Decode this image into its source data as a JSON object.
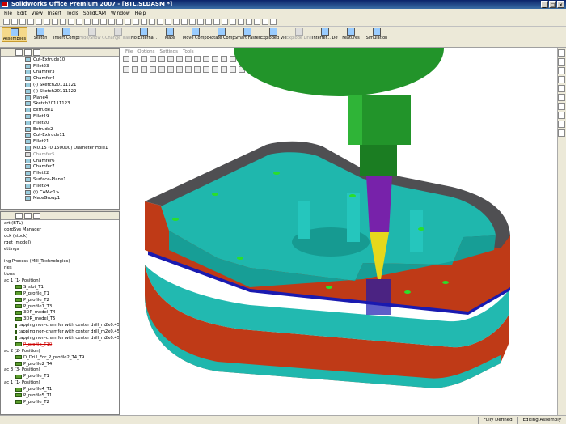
{
  "title": "SolidWorks Office Premium 2007 - [BTL.SLDASM *]",
  "menu": [
    "File",
    "Edit",
    "View",
    "Insert",
    "Tools",
    "SolidCAM",
    "Window",
    "Help"
  ],
  "commands": [
    {
      "label": "Assemblies",
      "state": "active"
    },
    {
      "label": "Sketch",
      "state": "normal"
    },
    {
      "label": "Insert Compon...",
      "state": "normal"
    },
    {
      "label": "Hide/Show Compon...",
      "state": "disabled"
    },
    {
      "label": "Change Transpar...",
      "state": "disabled"
    },
    {
      "label": "No External ...",
      "state": "normal"
    },
    {
      "label": "Mate",
      "state": "normal"
    },
    {
      "label": "Move Component",
      "state": "normal"
    },
    {
      "label": "Rotate Component",
      "state": "normal"
    },
    {
      "label": "Smart Fasteners",
      "state": "normal"
    },
    {
      "label": "Exploded View",
      "state": "normal"
    },
    {
      "label": "Explode Line Sketch",
      "state": "disabled"
    },
    {
      "label": "Interfer... Detection",
      "state": "normal"
    },
    {
      "label": "Features",
      "state": "normal"
    },
    {
      "label": "Simulation",
      "state": "normal"
    }
  ],
  "feature_tree": [
    {
      "label": "Cut-Extrude10",
      "dim": false
    },
    {
      "label": "Fillet23",
      "dim": false
    },
    {
      "label": "Chamfer3",
      "dim": false
    },
    {
      "label": "Chamfer4",
      "dim": false
    },
    {
      "label": "(-) Sketch20111121",
      "dim": false
    },
    {
      "label": "(-) Sketch20111122",
      "dim": false
    },
    {
      "label": "Plane4",
      "dim": false
    },
    {
      "label": "Sketch20111123",
      "dim": false
    },
    {
      "label": "Extrude1",
      "dim": false
    },
    {
      "label": "Fillet19",
      "dim": false
    },
    {
      "label": "Fillet20",
      "dim": false
    },
    {
      "label": "Extrude2",
      "dim": false
    },
    {
      "label": "Cut-Extrude11",
      "dim": false
    },
    {
      "label": "Fillet21",
      "dim": false
    },
    {
      "label": "M0.15 (0.150000) Diameter Hole1",
      "dim": false
    },
    {
      "label": "Chamfer5",
      "dim": true
    },
    {
      "label": "Chamfer6",
      "dim": false
    },
    {
      "label": "Chamfer7",
      "dim": false
    },
    {
      "label": "Fillet22",
      "dim": false
    },
    {
      "label": "Surface-Plane1",
      "dim": false
    },
    {
      "label": "Fillet24",
      "dim": false
    },
    {
      "label": "(f) CAM<1>",
      "dim": false
    },
    {
      "label": "MateGroup1",
      "dim": false
    }
  ],
  "cam_tree": [
    {
      "label": "art (BTL)",
      "indent": 0,
      "icon": false
    },
    {
      "label": "oordSys Manager",
      "indent": 0,
      "icon": false
    },
    {
      "label": "ock (stock)",
      "indent": 0,
      "icon": false
    },
    {
      "label": "rget (model)",
      "indent": 0,
      "icon": false
    },
    {
      "label": "ettings",
      "indent": 0,
      "icon": false
    },
    {
      "label": "",
      "indent": 0,
      "icon": false
    },
    {
      "label": "ing Process (Mill_Technologies)",
      "indent": 0,
      "icon": false
    },
    {
      "label": "ries",
      "indent": 0,
      "icon": false
    },
    {
      "label": "tions",
      "indent": 0,
      "icon": false
    },
    {
      "label": "ac 1 (1- Position)",
      "indent": 0,
      "icon": false
    },
    {
      "label": "S_slot_T1",
      "indent": 14,
      "icon": true
    },
    {
      "label": "P_profile_T1",
      "indent": 14,
      "icon": true
    },
    {
      "label": "P_profile_T2",
      "indent": 14,
      "icon": true
    },
    {
      "label": "P_profile1_T3",
      "indent": 14,
      "icon": true
    },
    {
      "label": "3DR_model_T4",
      "indent": 14,
      "icon": true
    },
    {
      "label": "3DR_model_T5",
      "indent": 14,
      "icon": true
    },
    {
      "label": "tapping non-chamfer with center drill_m2x0.45_cdrill",
      "indent": 14,
      "icon": true
    },
    {
      "label": "tapping non-chamfer with center drill_m2x0.45_drill",
      "indent": 14,
      "icon": true
    },
    {
      "label": "tapping non-chamfer with center drill_m2x0.45_tap",
      "indent": 14,
      "icon": true
    },
    {
      "label": "P_profile_T10",
      "indent": 14,
      "icon": true,
      "sel": true
    },
    {
      "label": "ac 2 (2- Position)",
      "indent": 0,
      "icon": false
    },
    {
      "label": "D_Drill_For_P_profile2_T4_T9",
      "indent": 14,
      "icon": true
    },
    {
      "label": "P_profile2_T4",
      "indent": 14,
      "icon": true
    },
    {
      "label": "ac 3 (3- Position)",
      "indent": 0,
      "icon": false
    },
    {
      "label": "P_profile_T1",
      "indent": 14,
      "icon": true
    },
    {
      "label": "ac 1 (1- Position)",
      "indent": 0,
      "icon": false
    },
    {
      "label": "P_profile4_T1",
      "indent": 14,
      "icon": true
    },
    {
      "label": "P_profile5_T1",
      "indent": 14,
      "icon": true
    },
    {
      "label": "P_profile_T2",
      "indent": 14,
      "icon": true
    }
  ],
  "viewport_menu": [
    "File",
    "Options",
    "Settings",
    "Tools"
  ],
  "status": {
    "left": "",
    "state": "Fully Defined",
    "mode": "Editing Assembly"
  },
  "colors": {
    "part": "#1fb7ad",
    "wall": "#bf3a17",
    "spindle": "#22942a",
    "tool": "#7722aa",
    "tip": "#e6d81c",
    "stripe": "#1a1ab0"
  }
}
